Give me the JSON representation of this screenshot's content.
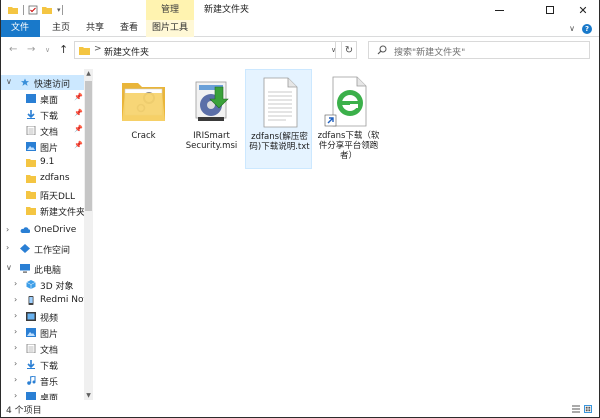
{
  "window": {
    "title": "新建文件夹",
    "context_group": "管理"
  },
  "ribbon": {
    "tabs": [
      {
        "label": "文件"
      },
      {
        "label": "主页"
      },
      {
        "label": "共享"
      },
      {
        "label": "查看"
      },
      {
        "label": "图片工具"
      }
    ]
  },
  "address": {
    "path": "新建文件夹",
    "separator": ">",
    "search_placeholder": "搜索\"新建文件夹\""
  },
  "nav": {
    "items": [
      {
        "label": "快速访问"
      },
      {
        "label": "桌面"
      },
      {
        "label": "下载"
      },
      {
        "label": "文档"
      },
      {
        "label": "图片"
      },
      {
        "label": "9.1"
      },
      {
        "label": "zdfans"
      },
      {
        "label": "陌天DLL"
      },
      {
        "label": "新建文件夹"
      },
      {
        "label": "OneDrive"
      },
      {
        "label": "工作空间"
      },
      {
        "label": "此电脑"
      },
      {
        "label": "3D 对象"
      },
      {
        "label": "Redmi Note"
      },
      {
        "label": "视频"
      },
      {
        "label": "图片"
      },
      {
        "label": "文档"
      },
      {
        "label": "下载"
      },
      {
        "label": "音乐"
      },
      {
        "label": "桌面"
      }
    ]
  },
  "files": [
    {
      "name": "Crack",
      "icon": "folder-icon"
    },
    {
      "name": "IRISmart Security.msi",
      "icon": "installer-icon"
    },
    {
      "name": "zdfans(解压密码)下载说明.txt",
      "icon": "text-file-icon"
    },
    {
      "name": "zdfans下载（软件分享平台领跑者）",
      "icon": "ie-shortcut-icon"
    }
  ],
  "status": {
    "count": "4 个项目"
  },
  "colors": {
    "accent": "#1979ca",
    "selection": "#cce8ff",
    "context_tab": "#fff3b0",
    "folder": "#f4c542"
  }
}
